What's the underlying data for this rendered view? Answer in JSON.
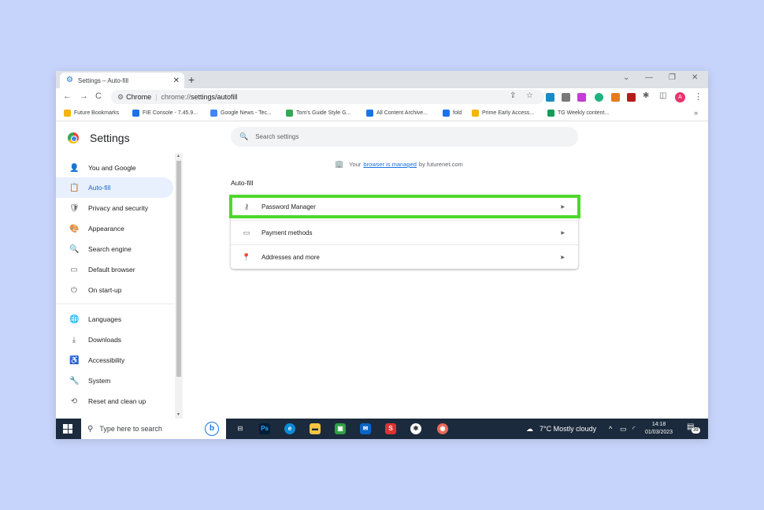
{
  "browser": {
    "tab_title": "Settings – Auto-fill",
    "new_tab_symbol": "+",
    "window_controls": [
      "⌄",
      "—",
      "❐",
      "✕"
    ],
    "address_chip": "Chrome",
    "address_scheme": "chrome://",
    "address_path": "settings/autofill"
  },
  "bookmarks": [
    {
      "label": "Future Bookmarks",
      "color": "#f4b400"
    },
    {
      "label": "FIE Console - 7.45.9...",
      "color": "#1a73e8"
    },
    {
      "label": "Google News - Tec...",
      "color": "#4285f4"
    },
    {
      "label": "Tom's Guide Style G...",
      "color": "#34a853"
    },
    {
      "label": "All Content Archive...",
      "color": "#1a73e8"
    },
    {
      "label": "fold",
      "color": "#1a73e8"
    },
    {
      "label": "Prime Early Access...",
      "color": "#f4b400"
    },
    {
      "label": "TG Weekly content...",
      "color": "#0f9d58"
    }
  ],
  "settings": {
    "title": "Settings",
    "search_placeholder": "Search settings",
    "sidebar": [
      {
        "label": "You and Google",
        "icon": "person-icon",
        "glyph": "👤"
      },
      {
        "label": "Auto-fill",
        "icon": "clipboard-icon",
        "glyph": "📋"
      },
      {
        "label": "Privacy and security",
        "icon": "shield-icon",
        "glyph": "🛡"
      },
      {
        "label": "Appearance",
        "icon": "palette-icon",
        "glyph": "🎨"
      },
      {
        "label": "Search engine",
        "icon": "search-icon",
        "glyph": "🔍"
      },
      {
        "label": "Default browser",
        "icon": "browser-icon",
        "glyph": "▭"
      },
      {
        "label": "On start-up",
        "icon": "power-icon",
        "glyph": "⏻"
      },
      {
        "label": "Languages",
        "icon": "globe-icon",
        "glyph": "🌐"
      },
      {
        "label": "Downloads",
        "icon": "download-icon",
        "glyph": "⤓"
      },
      {
        "label": "Accessibility",
        "icon": "accessibility-icon",
        "glyph": "♿"
      },
      {
        "label": "System",
        "icon": "wrench-icon",
        "glyph": "🔧"
      },
      {
        "label": "Reset and clean up",
        "icon": "restore-icon",
        "glyph": "⟲"
      }
    ],
    "managed_prefix": "Your",
    "managed_link": "browser is managed",
    "managed_suffix": "by futurenet.com",
    "section_title": "Auto-fill",
    "rows": [
      {
        "label": "Password Manager",
        "icon": "key-icon",
        "glyph": "⚷"
      },
      {
        "label": "Payment methods",
        "icon": "credit-card-icon",
        "glyph": "▭"
      },
      {
        "label": "Addresses and more",
        "icon": "location-pin-icon",
        "glyph": "📍"
      }
    ],
    "row_arrow": "▶"
  },
  "taskbar": {
    "search_placeholder": "Type here to search",
    "weather": "7°C  Mostly cloudy",
    "time": "14:18",
    "date": "01/03/2023",
    "notification_count": "39"
  }
}
